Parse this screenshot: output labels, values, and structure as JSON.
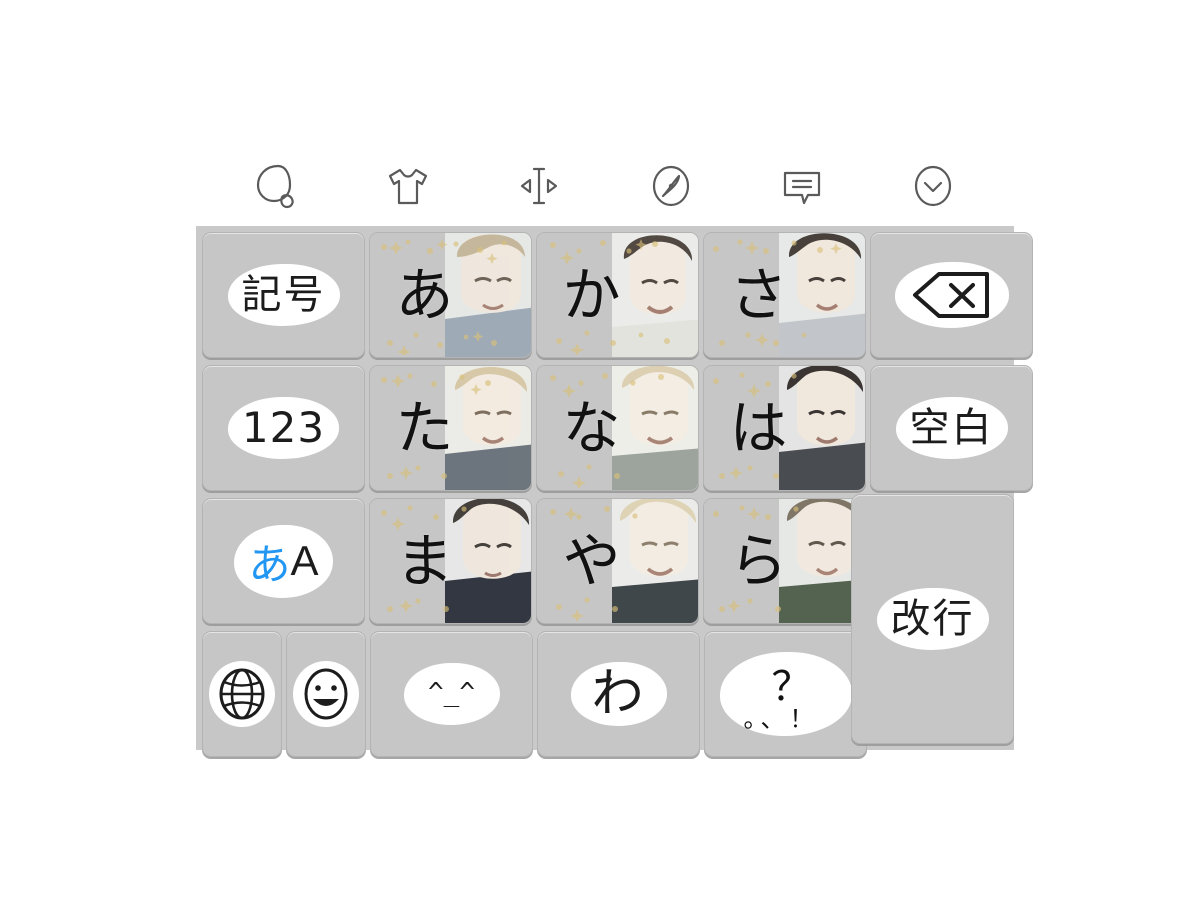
{
  "app": {
    "name": "Japanese 12-key flick keyboard",
    "background_color": "#ffffff",
    "panel_color": "#c9c9c9",
    "key_color": "#c6c6c6",
    "label_blob_color": "#ffffff",
    "accent_blue": "#2196f3"
  },
  "toolbar": {
    "items": [
      {
        "name": "search-icon",
        "label": "Search"
      },
      {
        "name": "tshirt-icon",
        "label": "Theme"
      },
      {
        "name": "cursor-move-icon",
        "label": "Cursor move"
      },
      {
        "name": "compass-icon",
        "label": "Explore"
      },
      {
        "name": "speech-bubble-icon",
        "label": "Phrases"
      },
      {
        "name": "chevron-down-circle-icon",
        "label": "Collapse"
      }
    ]
  },
  "keyboard": {
    "rows": [
      {
        "keys": [
          {
            "id": "symbol",
            "label": "記号",
            "type": "function",
            "style": "blob"
          },
          {
            "id": "a-row",
            "label": "あ",
            "type": "kana",
            "style": "photo"
          },
          {
            "id": "ka-row",
            "label": "か",
            "type": "kana",
            "style": "photo"
          },
          {
            "id": "sa-row",
            "label": "さ",
            "type": "kana",
            "style": "photo"
          },
          {
            "id": "backspace",
            "label": "",
            "type": "function",
            "style": "blob",
            "icon": "backspace-icon"
          }
        ]
      },
      {
        "keys": [
          {
            "id": "numbers",
            "label": "123",
            "type": "function",
            "style": "blob"
          },
          {
            "id": "ta-row",
            "label": "た",
            "type": "kana",
            "style": "photo"
          },
          {
            "id": "na-row",
            "label": "な",
            "type": "kana",
            "style": "photo"
          },
          {
            "id": "ha-row",
            "label": "は",
            "type": "kana",
            "style": "photo"
          },
          {
            "id": "space",
            "label": "空白",
            "type": "function",
            "style": "blob"
          }
        ]
      },
      {
        "keys": [
          {
            "id": "input-mode",
            "label_kana": "あ",
            "label_latin": "A",
            "type": "function",
            "style": "blob"
          },
          {
            "id": "ma-row",
            "label": "ま",
            "type": "kana",
            "style": "photo"
          },
          {
            "id": "ya-row",
            "label": "や",
            "type": "kana",
            "style": "photo"
          },
          {
            "id": "ra-row",
            "label": "ら",
            "type": "kana",
            "style": "photo"
          },
          {
            "id": "enter",
            "label": "改行",
            "type": "function",
            "style": "blob",
            "span_rows": 2
          }
        ]
      },
      {
        "keys": [
          {
            "id": "globe",
            "label": "",
            "type": "function",
            "style": "blob",
            "icon": "globe-icon"
          },
          {
            "id": "emoji",
            "label": "",
            "type": "function",
            "style": "blob",
            "icon": "smiley-icon"
          },
          {
            "id": "kaomoji",
            "label": "^_^",
            "type": "function",
            "style": "blob"
          },
          {
            "id": "wa-row",
            "label": "わ",
            "type": "kana",
            "style": "blob"
          },
          {
            "id": "punctuation",
            "label_top": "？",
            "label_bottom": "。、！",
            "type": "function",
            "style": "blob"
          }
        ]
      }
    ]
  }
}
